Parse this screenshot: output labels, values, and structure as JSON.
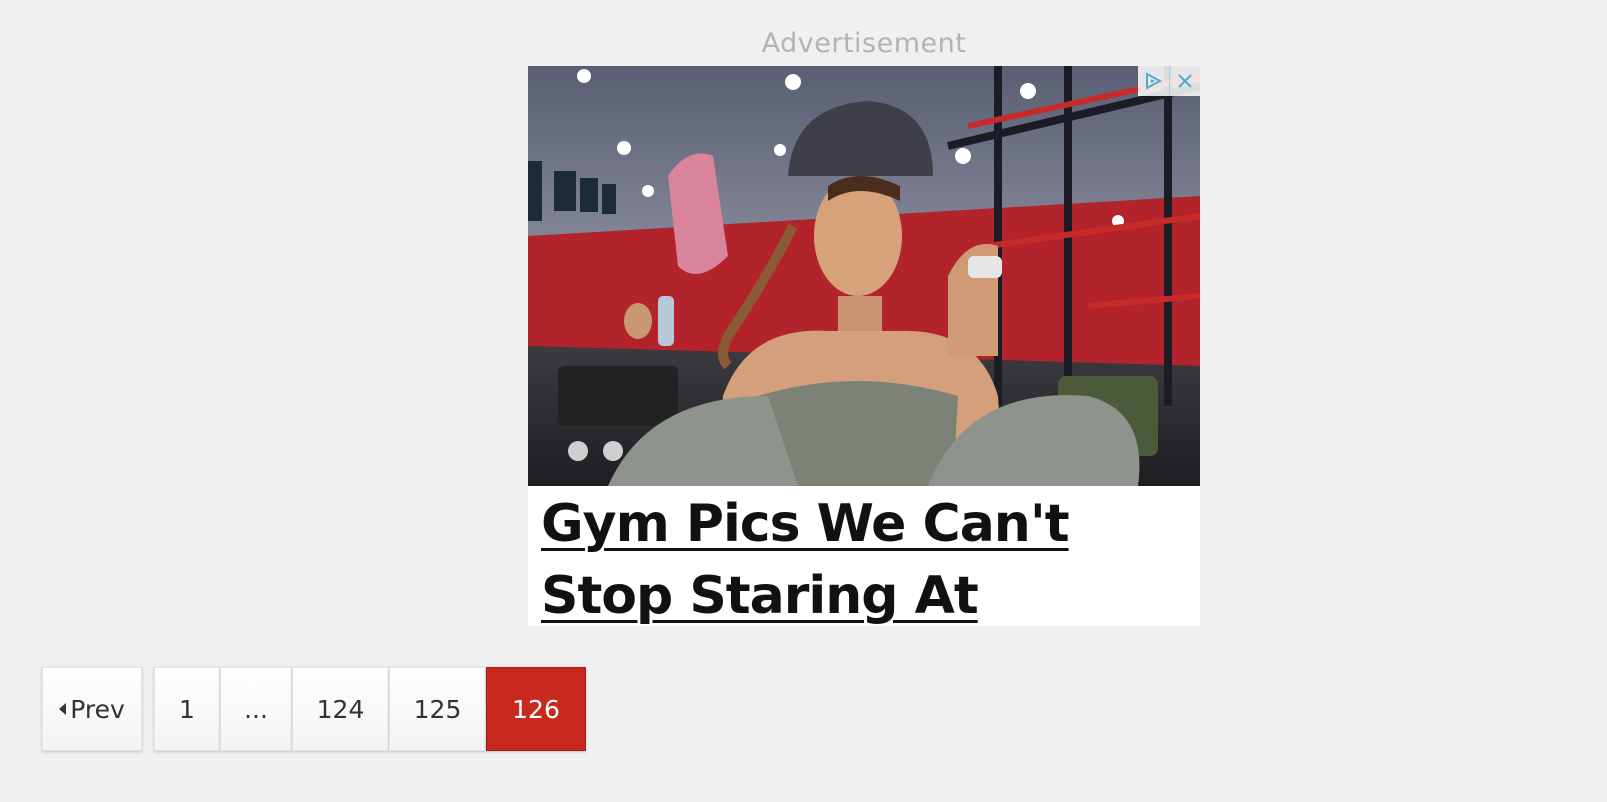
{
  "advertisement": {
    "label": "Advertisement",
    "headline": "Gym Pics We Can't Stop Staring At",
    "icons": [
      "adchoices-icon",
      "close-icon"
    ],
    "accent_color": "#4aaed1"
  },
  "pagination": {
    "prev_label": "Prev",
    "pages": [
      "1",
      "...",
      "124",
      "125",
      "126"
    ],
    "current": "126",
    "active_color": "#c8291f"
  }
}
